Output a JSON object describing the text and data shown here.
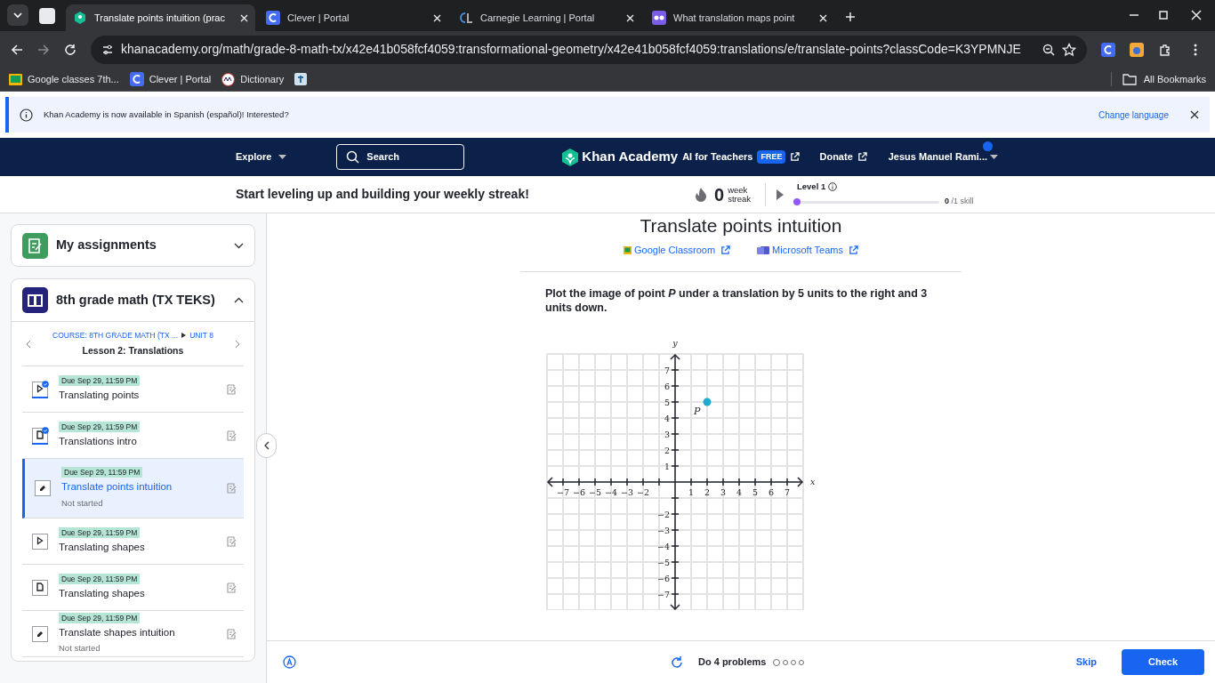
{
  "browser": {
    "tabs": [
      {
        "title": "Translate points intuition (prac",
        "selected": true
      },
      {
        "title": "Clever | Portal",
        "selected": false
      },
      {
        "title": "Carnegie Learning | Portal",
        "selected": false
      },
      {
        "title": "What translation maps point",
        "selected": false
      }
    ],
    "url": "khanacademy.org/math/grade-8-math-tx/x42e41b058fcf4059:transformational-geometry/x42e41b058fcf4059:translations/e/translate-points?classCode=K3YPMNJE",
    "bookmarks": [
      "Google classes 7th...",
      "Clever | Portal",
      "Dictionary"
    ],
    "all_bookmarks": "All Bookmarks"
  },
  "banner": {
    "text": "Khan Academy is now available in Spanish (español)! Interested?",
    "action": "Change language"
  },
  "nav": {
    "explore": "Explore",
    "search": "Search",
    "logo": "Khan Academy",
    "ai": "AI for Teachers",
    "ai_badge": "FREE",
    "donate": "Donate",
    "user": "Jesus Manuel Rami..."
  },
  "streak": {
    "message": "Start leveling up and building your weekly streak!",
    "count": "0",
    "unit_1": "week",
    "unit_2": "streak",
    "level_label": "Level 1",
    "level": 0.0,
    "count_label": "0",
    "skill_label": "/1 skill"
  },
  "sidebar": {
    "assignments": {
      "title": "My assignments",
      "expanded": false
    },
    "course": {
      "title": "8th grade math (TX TEKS)",
      "expanded": true,
      "breadcrumb_course": "COURSE: 8TH GRADE MATH (TX ...",
      "breadcrumb_unit": "UNIT 8",
      "lesson": "Lesson 2: Translations"
    },
    "items": [
      {
        "kind": "video",
        "done": true,
        "selected": false,
        "due": "Due Sep 29, 11:59 PM",
        "title": "Translating points"
      },
      {
        "kind": "article",
        "done": true,
        "selected": false,
        "due": "Due Sep 29, 11:59 PM",
        "title": "Translations intro"
      },
      {
        "kind": "exercise",
        "done": false,
        "selected": true,
        "due": "Due Sep 29, 11:59 PM",
        "title": "Translate points intuition",
        "status": "Not started"
      },
      {
        "kind": "video",
        "done": false,
        "selected": false,
        "due": "Due Sep 29, 11:59 PM",
        "title": "Translating shapes"
      },
      {
        "kind": "article",
        "done": false,
        "selected": false,
        "due": "Due Sep 29, 11:59 PM",
        "title": "Translating shapes"
      },
      {
        "kind": "exercise",
        "done": false,
        "selected": false,
        "due": "Due Sep 29, 11:59 PM",
        "title": "Translate shapes intuition",
        "status": "Not started"
      }
    ]
  },
  "exercise": {
    "title": "Translate points intuition",
    "share": [
      "Google Classroom",
      "Microsoft Teams"
    ],
    "question": "Plot the image of point *P* under a translation by 5 units to the right and 3 units down.",
    "chart_data": {
      "type": "scatter",
      "grid": true,
      "xlabel": "x",
      "ylabel": "y",
      "xlim": [
        -8,
        8
      ],
      "ylim": [
        -8,
        8
      ],
      "x": [
        2
      ],
      "series": [
        {
          "name": "P",
          "color": "#1fabd0",
          "values": [
            5
          ]
        }
      ],
      "xticks": [
        -7,
        -6,
        -5,
        -4,
        -3,
        -2,
        1,
        2,
        3,
        4,
        5,
        6,
        7
      ],
      "yticks": [
        -7,
        -6,
        -5,
        -4,
        -3,
        -2,
        1,
        2,
        3,
        4,
        5,
        6,
        7
      ]
    }
  },
  "footer": {
    "progress": "Do 4 problems",
    "problems": [
      {
        "done": false
      },
      {
        "done": false
      },
      {
        "done": false
      },
      {
        "done": false
      }
    ],
    "skip": "Skip",
    "check": "Check"
  }
}
